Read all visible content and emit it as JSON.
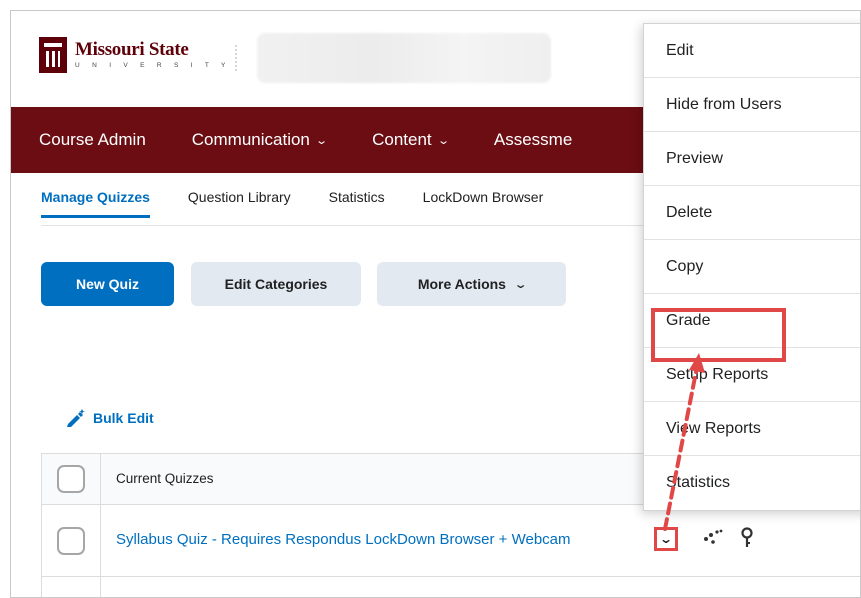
{
  "brand": {
    "name": "Missouri State",
    "sub": "U N I V E R S I T Y"
  },
  "nav": {
    "items": [
      {
        "label": "Course Admin",
        "chevron": false
      },
      {
        "label": "Communication",
        "chevron": true
      },
      {
        "label": "Content",
        "chevron": true
      },
      {
        "label": "Assessme",
        "chevron": false
      }
    ]
  },
  "tabs": [
    "Manage Quizzes",
    "Question Library",
    "Statistics",
    "LockDown Browser"
  ],
  "buttons": {
    "new_quiz": "New Quiz",
    "edit_categories": "Edit Categories",
    "more_actions": "More Actions"
  },
  "bulk_edit": "Bulk Edit",
  "table": {
    "header": "Current Quizzes",
    "rows": [
      {
        "title": "Syllabus Quiz - Requires Respondus LockDown Browser + Webcam"
      }
    ]
  },
  "menu": {
    "items": [
      "Edit",
      "Hide from Users",
      "Preview",
      "Delete",
      "Copy",
      "Grade",
      "Setup Reports",
      "View Reports",
      "Statistics"
    ],
    "highlighted": "Grade"
  },
  "colors": {
    "brand": "#6b0d12",
    "primary": "#006fbf",
    "annotation": "#e04848"
  },
  "icons": [
    "missouri-state-logo-icon",
    "chevron-down-icon",
    "pencil-magic-icon",
    "dots-icon",
    "key-icon"
  ]
}
